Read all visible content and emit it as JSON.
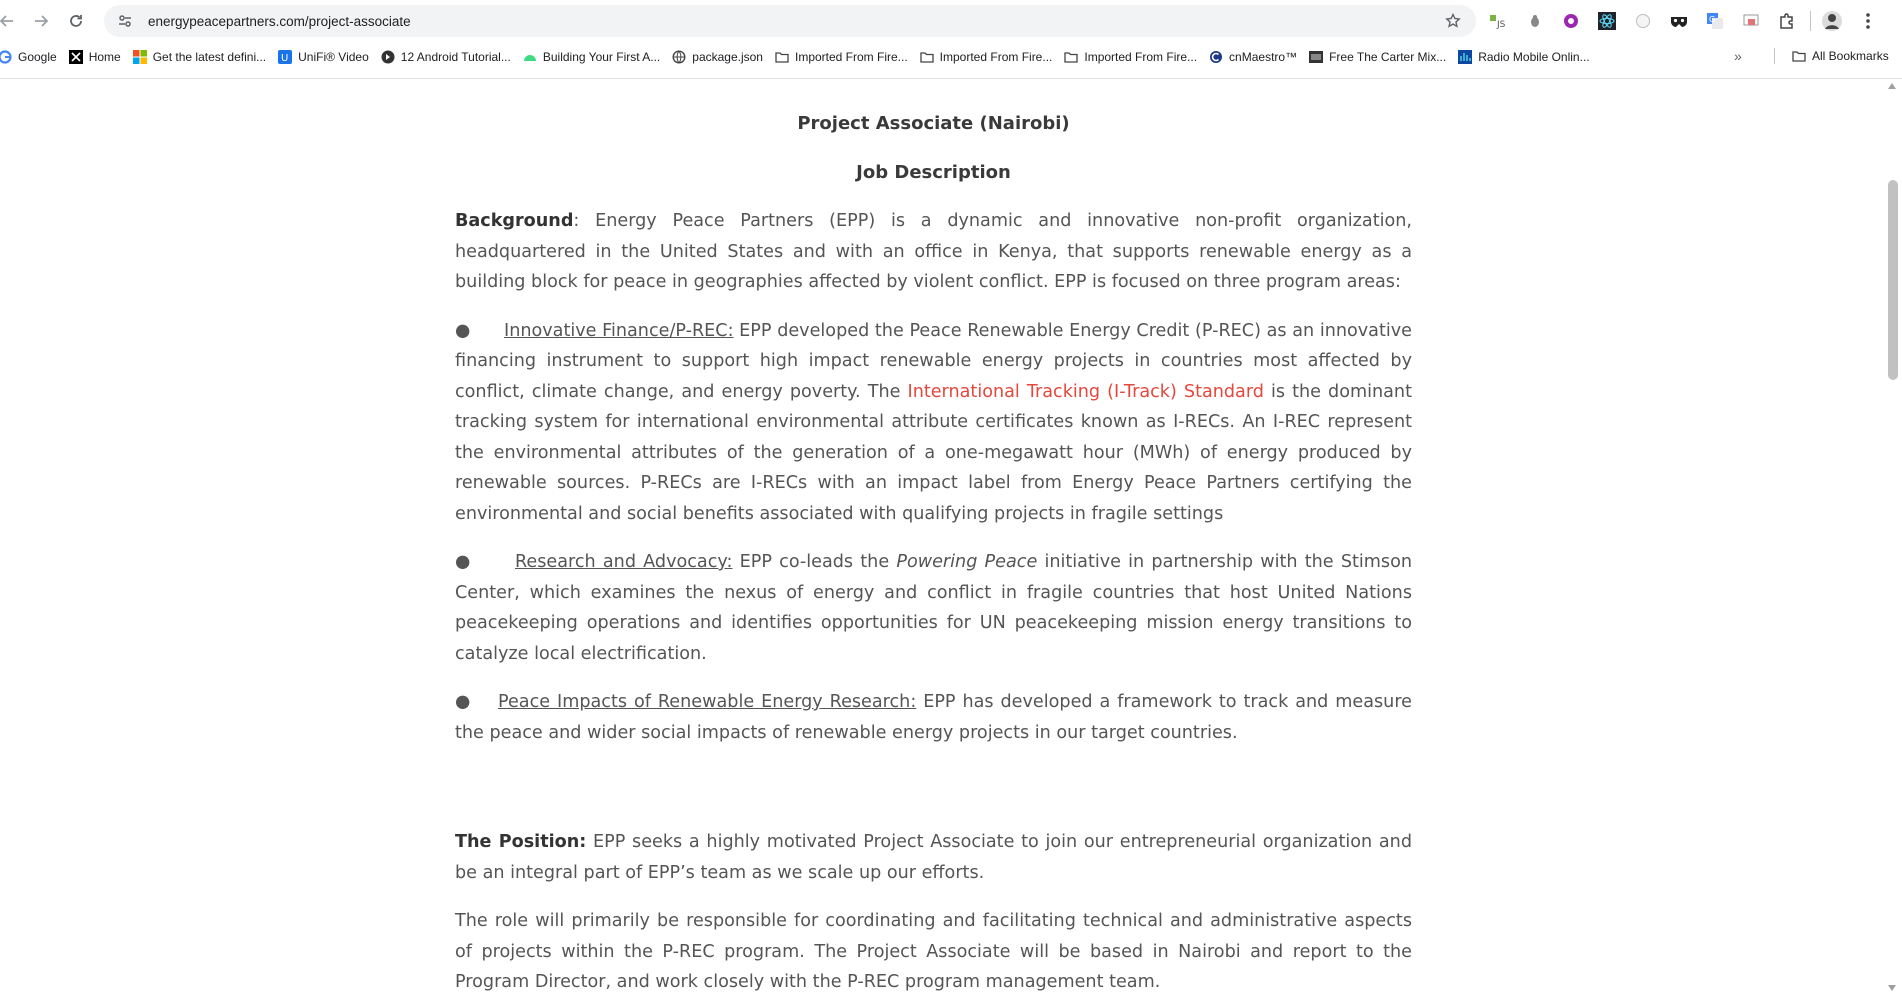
{
  "browser": {
    "url": "energypeacepartners.com/project-associate",
    "bookmarks": [
      {
        "label": "Google",
        "icon": "google-icon"
      },
      {
        "label": "Home",
        "icon": "x-icon"
      },
      {
        "label": "Get the latest defini...",
        "icon": "windows-icon"
      },
      {
        "label": "UniFi® Video",
        "icon": "unifi-icon"
      },
      {
        "label": "12 Android Tutorial...",
        "icon": "android-tutorial-icon"
      },
      {
        "label": "Building Your First A...",
        "icon": "android-icon"
      },
      {
        "label": "package.json",
        "icon": "globe-icon"
      },
      {
        "label": "Imported From Fire...",
        "icon": "folder-icon"
      },
      {
        "label": "Imported From Fire...",
        "icon": "folder-icon"
      },
      {
        "label": "Imported From Fire...",
        "icon": "folder-icon"
      },
      {
        "label": "cnMaestro™",
        "icon": "cnmaestro-icon"
      },
      {
        "label": "Free The Carter Mix...",
        "icon": "music-icon"
      },
      {
        "label": "Radio Mobile Onlin...",
        "icon": "radio-icon"
      }
    ],
    "more_label": "»",
    "all_bookmarks": "All Bookmarks"
  },
  "page": {
    "title": "Project Associate (Nairobi)",
    "subtitle": "Job Description",
    "background": {
      "label": "Background",
      "text": ": Energy Peace Partners (EPP) is a dynamic and innovative non-profit organization, headquartered in the United States and with an office in Kenya, that supports renewable energy as a building block for peace in geographies affected by violent conflict. EPP is focused on three program areas:"
    },
    "bullet_char": "●",
    "program1": {
      "heading": "Innovative Finance/P-REC:",
      "text_a": " EPP developed the Peace Renewable Energy Credit (P-REC) as an innovative financing instrument to support high impact renewable energy projects in countries most affected by conflict, climate change, and energy poverty. The ",
      "link": "International Tracking (I-Track) Standard",
      "text_b": " is the dominant tracking system for international environmental attribute certificates known as I-RECs.  An I-REC represent the environmental attributes of the generation of a one-megawatt hour (MWh) of energy produced by renewable sources. P-RECs are I-RECs with an impact label from Energy Peace Partners certifying the environmental and social benefits associated with qualifying projects in fragile settings"
    },
    "program2": {
      "heading": "Research and Advocacy:",
      "text_a": " EPP co-leads the ",
      "italic": "Powering Peace",
      "text_b": " initiative in partnership with the Stimson Center, which examines the nexus of energy and conflict in fragile countries that host United Nations peacekeeping operations and identifies opportunities for UN peacekeeping mission energy transitions to catalyze local electrification."
    },
    "program3": {
      "heading": "Peace Impacts of Renewable Energy Research:",
      "text": " EPP has developed a framework to track and measure the peace and wider social impacts of renewable energy projects in our target countries."
    },
    "position": {
      "label": "The Position:",
      "text": " EPP seeks a highly motivated Project Associate to join our entrepreneurial organization and be an integral part of EPP’s team as we scale up our efforts."
    },
    "role": {
      "text": "The role will primarily be responsible for coordinating and facilitating technical and administrative aspects of projects within the P-REC program.  The Project Associate will be based in Nairobi and report to the Program Director, and work closely with the P-REC program management team."
    }
  },
  "colors": {
    "link_red": "#e5473c",
    "body_text": "#555555",
    "heading_text": "#3a3a3a"
  }
}
